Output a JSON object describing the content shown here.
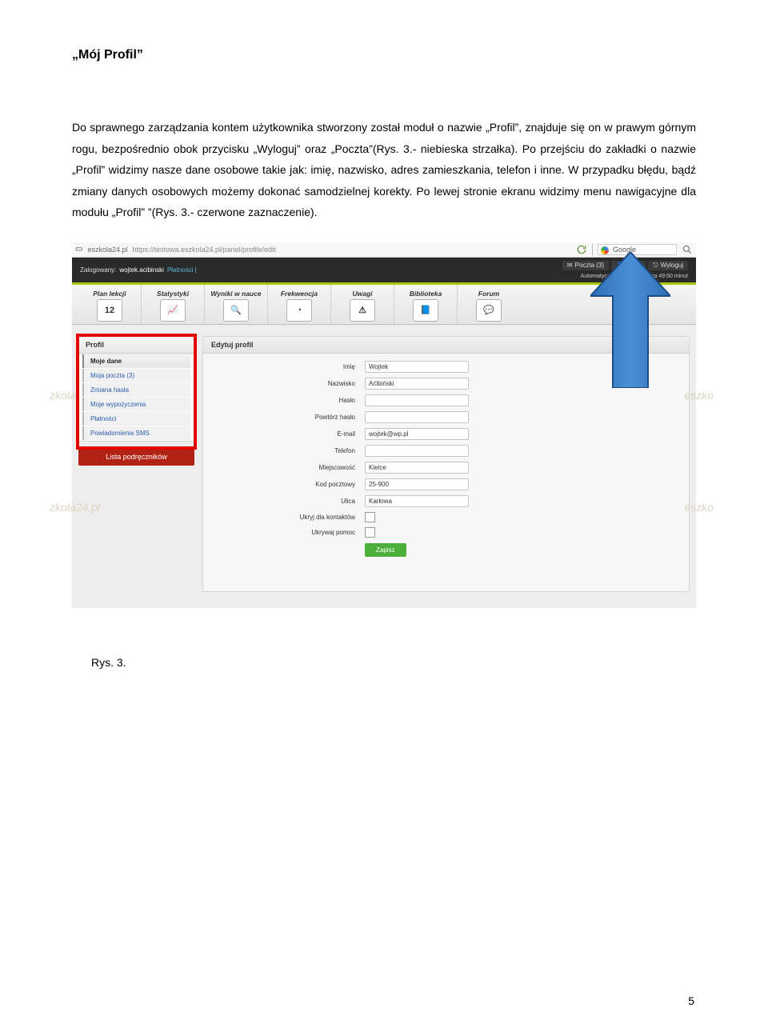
{
  "title": "„Mój Profil”",
  "paragraph": "Do sprawnego zarządzania kontem użytkownika stworzony został moduł o nazwie „Profil”, znajduje się on w prawym górnym rogu, bezpośrednio obok przycisku „Wyloguj” oraz „Poczta”(Rys. 3.- niebieska strzałka). Po przejściu do zakładki o nazwie „Profil” widzimy nasze dane osobowe takie jak: imię, nazwisko, adres zamieszkania, telefon i inne. W przypadku błędu, bądź zmiany danych osobowych możemy dokonać samodzielnej korekty. Po lewej stronie ekranu widzimy menu nawigacyjne dla modułu „Profil” ”(Rys. 3.- czerwone zaznaczenie).",
  "browser": {
    "site": "eszkola24.pl",
    "url": "https://testowa.eszkola24.pl/panel/profile/edit",
    "search": "Google"
  },
  "darkbar": {
    "logged_label": "Zalogowany:",
    "user": "wojtek.acibinski",
    "role": "Płatności |",
    "poczta": "Poczta (3)",
    "profil": "Profil",
    "wyloguj": "Wyloguj",
    "autolog": "Automatyczne wylogowanie za 49:50 minut"
  },
  "nav": [
    {
      "label": "Plan lekcji",
      "icon": "12"
    },
    {
      "label": "Statystyki",
      "icon": "📈"
    },
    {
      "label": "Wyniki w nauce",
      "icon": "🔍"
    },
    {
      "label": "Frekwencja",
      "icon": "◔"
    },
    {
      "label": "Uwagi",
      "icon": "⚠"
    },
    {
      "label": "Biblioteka",
      "icon": "📘"
    },
    {
      "label": "Forum",
      "icon": "💬"
    }
  ],
  "side": {
    "head": "Profil",
    "items": [
      {
        "label": "Moje dane",
        "active": true
      },
      {
        "label": "Moja poczta (3)"
      },
      {
        "label": "Zmiana hasła"
      },
      {
        "label": "Moje wypożyczenia"
      },
      {
        "label": "Płatności"
      },
      {
        "label": "Powiadomienia SMS"
      }
    ],
    "button": "Lista podręczników"
  },
  "main": {
    "head": "Edytuj profil",
    "rows": [
      {
        "label": "Imię",
        "value": "Wojtek",
        "type": "text"
      },
      {
        "label": "Nazwisko",
        "value": "Aćibiński",
        "type": "text"
      },
      {
        "label": "Hasło",
        "value": "",
        "type": "text"
      },
      {
        "label": "Powtórz hasło",
        "value": "",
        "type": "text"
      },
      {
        "label": "E-mail",
        "value": "wojtek@wp.pl",
        "type": "text"
      },
      {
        "label": "Telefon",
        "value": "",
        "type": "text"
      },
      {
        "label": "Miejscowość",
        "value": "Kielce",
        "type": "text"
      },
      {
        "label": "Kod pocztowy",
        "value": "25-900",
        "type": "text"
      },
      {
        "label": "Ulica",
        "value": "Karłowa",
        "type": "text"
      },
      {
        "label": "Ukryj dla kontaktów",
        "value": "",
        "type": "check"
      },
      {
        "label": "Ukrywaj pomoc",
        "value": "",
        "type": "check"
      }
    ],
    "save": "Zapisz"
  },
  "watermark": {
    "left": "zkola24.pl",
    "right": "eszko"
  },
  "caption": "Rys. 3.",
  "pagenum": "5"
}
